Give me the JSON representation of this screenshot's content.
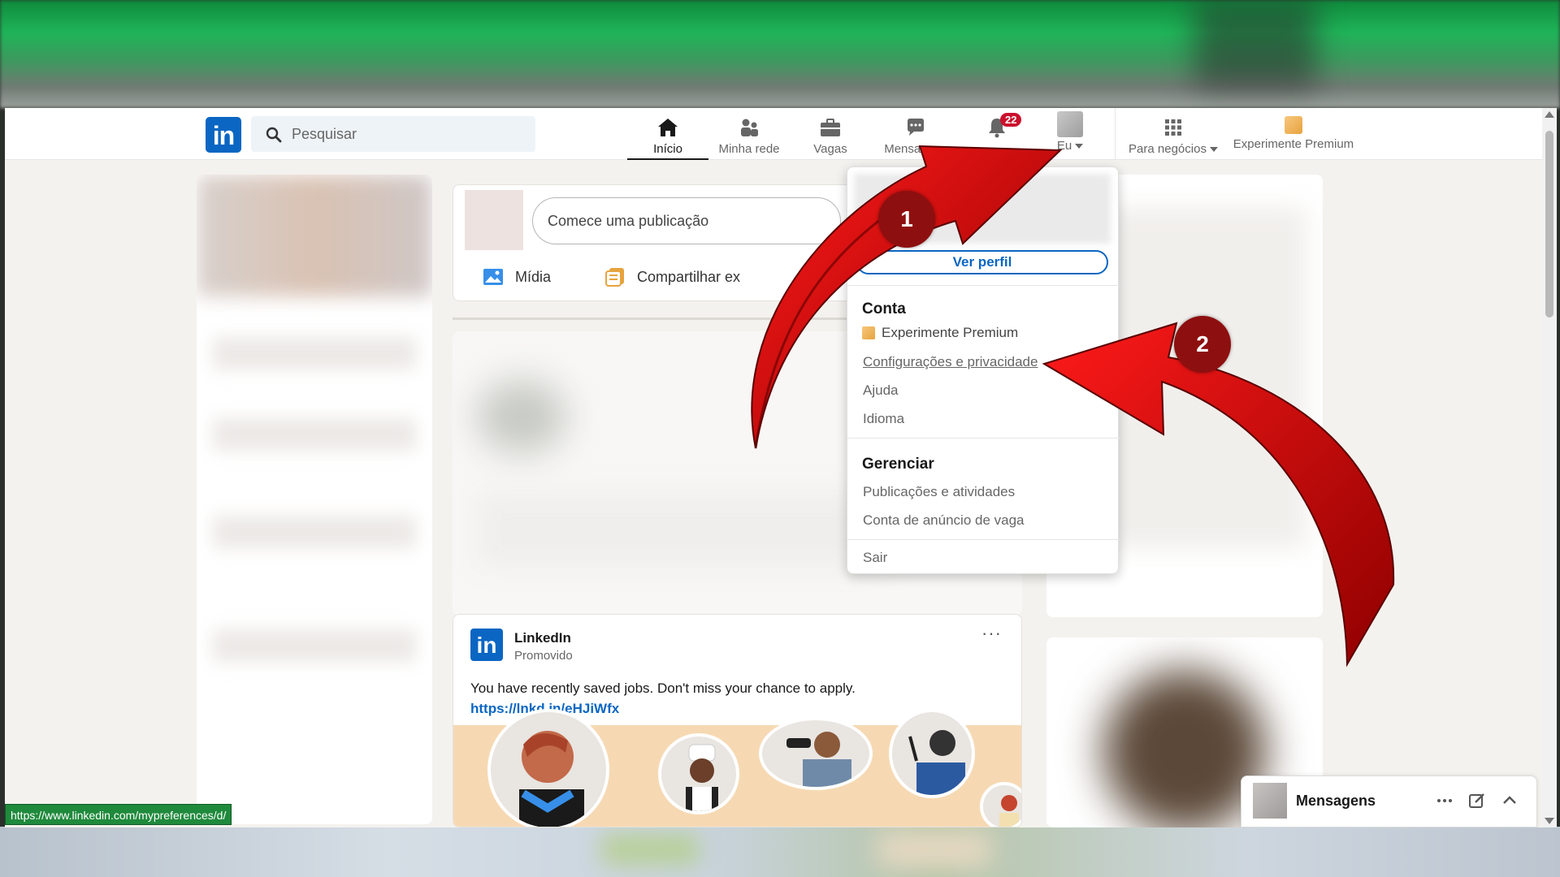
{
  "nav": {
    "logo": "in",
    "search_placeholder": "Pesquisar",
    "items": [
      {
        "label": "Início",
        "icon": "home-icon"
      },
      {
        "label": "Minha rede",
        "icon": "network-icon"
      },
      {
        "label": "Vagas",
        "icon": "briefcase-icon"
      },
      {
        "label": "Mensagens",
        "icon": "messaging-icon"
      },
      {
        "label": "",
        "icon": "notifications-icon",
        "badge": "22"
      },
      {
        "label": "Eu",
        "icon": "avatar"
      },
      {
        "label": "Para negócios",
        "icon": "grid-icon"
      },
      {
        "label": "Experimente Premium",
        "icon": "premium-icon"
      }
    ]
  },
  "post_box": {
    "placeholder": "Comece uma publicação",
    "media_label": "Mídia",
    "share_label": "Compartilhar ex"
  },
  "promo": {
    "logo": "in",
    "company": "LinkedIn",
    "subtitle": "Promovido",
    "more": "···",
    "text": "You have recently saved jobs. Don't miss your chance to apply.",
    "link": "https://lnkd.in/eHJiWfx"
  },
  "dropdown": {
    "view_profile": "Ver perfil",
    "account_title": "Conta",
    "premium": "Experimente Premium",
    "settings": "Configurações e privacidade",
    "help": "Ajuda",
    "language": "Idioma",
    "manage_title": "Gerenciar",
    "posts": "Publicações e atividades",
    "job_account": "Conta de anúncio de vaga",
    "logout": "Sair"
  },
  "messaging": {
    "title": "Mensagens"
  },
  "status_url": "https://www.linkedin.com/mypreferences/d/",
  "annotations": {
    "step1": "1",
    "step2": "2",
    "arrow_color": "#d90b0b"
  },
  "colors": {
    "brand": "#0a66c2",
    "badge": "#cb112d",
    "background": "#f4f2ee"
  }
}
